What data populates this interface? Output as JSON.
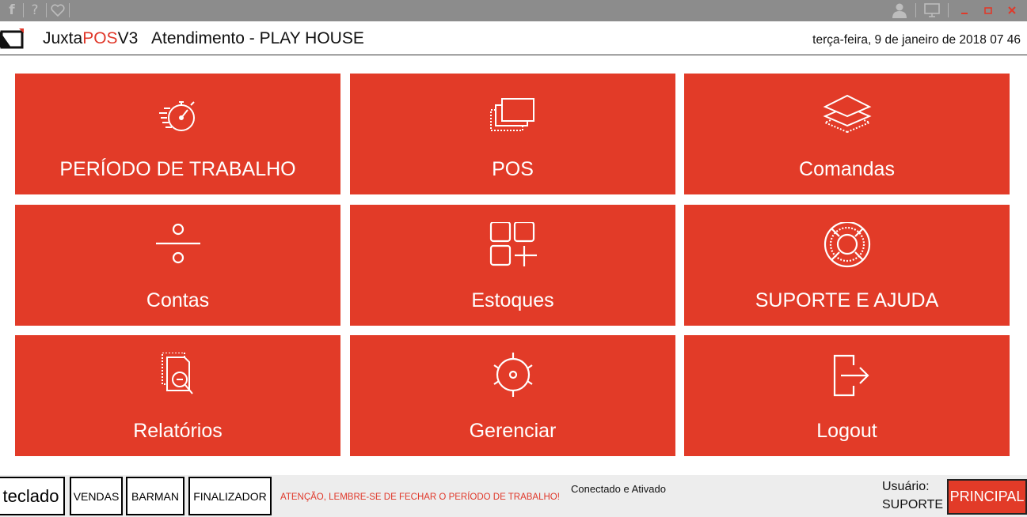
{
  "colors": {
    "accent": "#e23b28",
    "titlebar": "#8c8c8c"
  },
  "header": {
    "brand_prefix": "Juxta",
    "brand_accent": "POS",
    "brand_suffix": "V3",
    "title": "Atendimento - PLAY HOUSE",
    "datetime": "terça-feira, 9 de janeiro de 2018 07 46"
  },
  "titlebar": {
    "left_icons": [
      "facebook-icon",
      "help-icon",
      "heart-icon"
    ],
    "right_icons": [
      "user-icon",
      "monitor-icon",
      "minimize-icon",
      "maximize-icon",
      "close-icon"
    ]
  },
  "tiles": [
    {
      "label": "PERÍODO DE TRABALHO",
      "icon": "stopwatch-icon"
    },
    {
      "label": "POS",
      "icon": "layered-pages-icon"
    },
    {
      "label": "Comandas",
      "icon": "layers-icon"
    },
    {
      "label": "Contas",
      "icon": "divide-icon"
    },
    {
      "label": "Estoques",
      "icon": "grid-add-icon"
    },
    {
      "label": "SUPORTE E AJUDA",
      "icon": "lifebuoy-icon"
    },
    {
      "label": "Relatórios",
      "icon": "report-search-icon"
    },
    {
      "label": "Gerenciar",
      "icon": "target-gear-icon"
    },
    {
      "label": "Logout",
      "icon": "logout-icon"
    }
  ],
  "statusbar": {
    "teclado": "teclado",
    "vendas": "VENDAS",
    "barman": "BARMAN",
    "finalizador": "FINALIZADOR",
    "warning": "ATENÇÃO, LEMBRE-SE DE FECHAR O PERÍODO DE TRABALHO!",
    "status": "Conectado e Ativado",
    "user_label": "Usuário:",
    "user_name": "SUPORTE",
    "principal": "PRINCIPAL"
  }
}
